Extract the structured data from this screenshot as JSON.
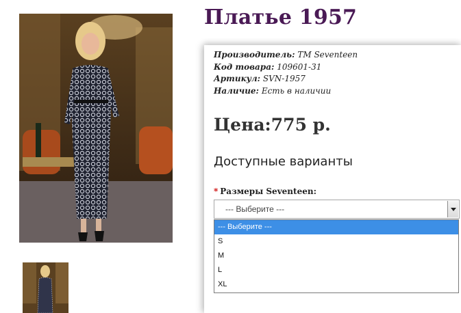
{
  "product": {
    "title": "Платье 1957"
  },
  "info": {
    "manufacturer_label": "Производитель:",
    "manufacturer_value": " TM Seventeen",
    "code_label": "Код товара:",
    "code_value": " 109601-31",
    "sku_label": "Артикул:",
    "sku_value": " SVN-1957",
    "availability_label": "Наличие:",
    "availability_value": " Есть в наличии"
  },
  "price": {
    "text": "Цена:775 р."
  },
  "options": {
    "heading": "Доступные варианты",
    "required_mark": "*",
    "size_label": "Размеры Seventeen:",
    "selected": "--- Выберите ---",
    "list": [
      "--- Выберите ---",
      "S",
      "M",
      "L",
      "XL"
    ]
  },
  "icons": {
    "select_arrow": "chevron-down-icon"
  }
}
